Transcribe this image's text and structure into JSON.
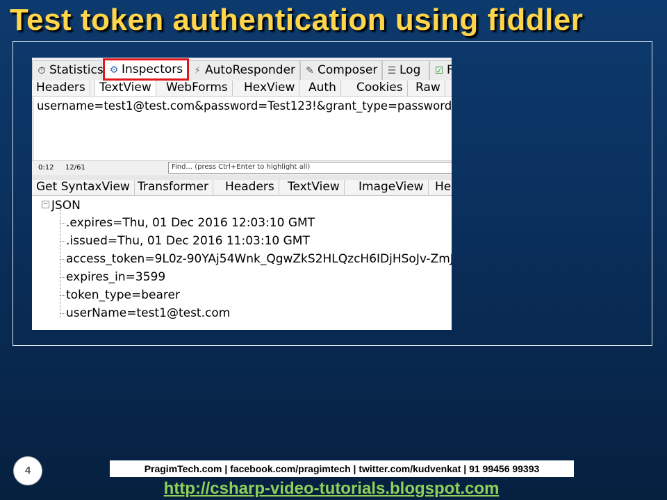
{
  "slide": {
    "title": "Test token authentication using fiddler",
    "page_number": "4"
  },
  "fiddler": {
    "main_tabs": [
      {
        "label": "Statistics",
        "icon": "stopwatch-icon"
      },
      {
        "label": "Inspectors",
        "icon": "inspector-icon",
        "active": true
      },
      {
        "label": "AutoResponder",
        "icon": "lightning-icon"
      },
      {
        "label": "Composer",
        "icon": "composer-icon"
      },
      {
        "label": "Log",
        "icon": "log-icon"
      },
      {
        "label": "F",
        "icon": "checkbox-icon"
      }
    ],
    "request_tabs": [
      "Headers",
      "TextView",
      "WebForms",
      "HexView",
      "Auth",
      "Cookies",
      "Raw"
    ],
    "request_body": "username=test1@test.com&password=Test123!&grant_type=password",
    "status": {
      "position": "0:12",
      "count": "12/61",
      "find_placeholder": "Find... (press Ctrl+Enter to highlight all)"
    },
    "response_tabs": [
      "Get SyntaxView",
      "Transformer",
      "Headers",
      "TextView",
      "ImageView",
      "He"
    ],
    "tree": {
      "root": "JSON",
      "nodes": [
        ".expires=Thu, 01 Dec 2016 12:03:10 GMT",
        ".issued=Thu, 01 Dec 2016 11:03:10 GMT",
        "access_token=9L0z-90YAj54Wnk_QgwZkS2HLQzcH6IDjHSoJv-ZmJ",
        "expires_in=3599",
        "token_type=bearer",
        "userName=test1@test.com"
      ]
    }
  },
  "footer": {
    "contact": "PragimTech.com | facebook.com/pragimtech  | twitter.com/kudvenkat  | 91 99456 99393",
    "link": "http://csharp-video-tutorials.blogspot.com"
  },
  "colors": {
    "title": "#ffd54a",
    "active_tab_border": "#e0161d",
    "link": "#8fd05a"
  }
}
